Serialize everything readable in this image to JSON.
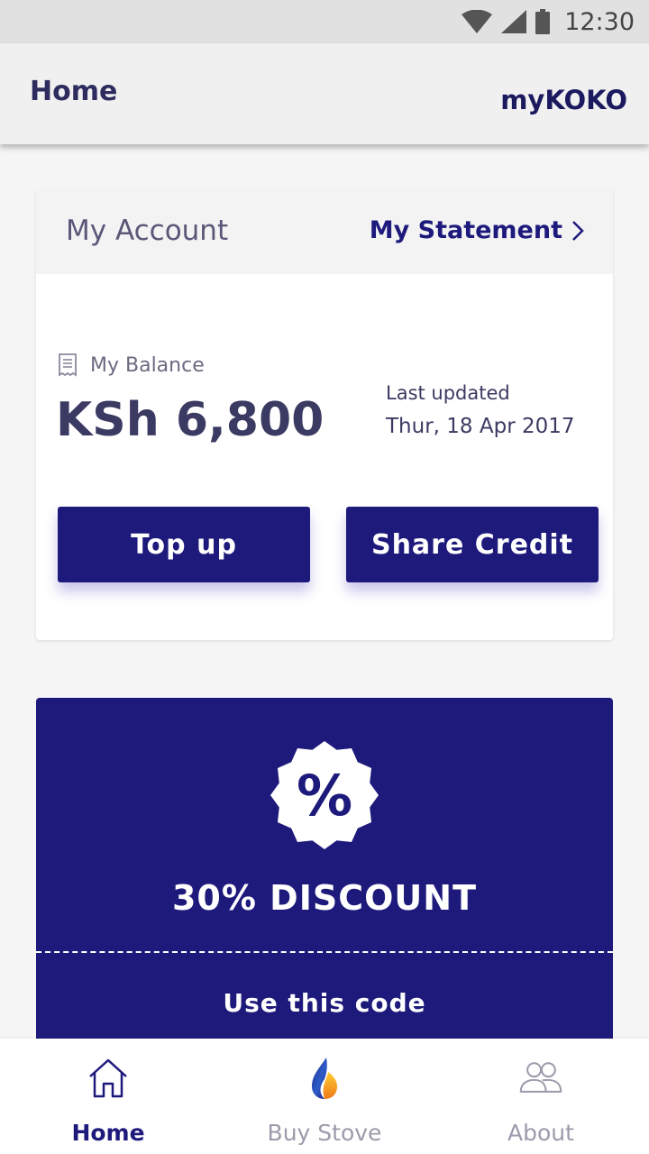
{
  "status_bar": {
    "time": "12:30"
  },
  "app_bar": {
    "title": "Home",
    "brand": "myKOKO"
  },
  "account": {
    "heading": "My Account",
    "statement_link": "My Statement",
    "balance_label": "My Balance",
    "balance_value": "KSh 6,800",
    "last_updated_label": "Last updated",
    "last_updated_date": "Thur, 18 Apr 2017",
    "top_up_label": "Top up",
    "share_credit_label": "Share Credit"
  },
  "discount": {
    "badge_symbol": "%",
    "title": "30% DISCOUNT",
    "code_label": "Use this code"
  },
  "bottom_nav": {
    "items": [
      {
        "label": "Home",
        "icon": "home-icon",
        "active": true
      },
      {
        "label": "Buy Stove",
        "icon": "flame-icon",
        "active": false
      },
      {
        "label": "About",
        "icon": "people-icon",
        "active": false
      }
    ]
  },
  "colors": {
    "primary": "#1e1a7c",
    "text_dark": "#2e2c5e",
    "muted": "#9c9bab",
    "background": "#f5f5f6"
  }
}
